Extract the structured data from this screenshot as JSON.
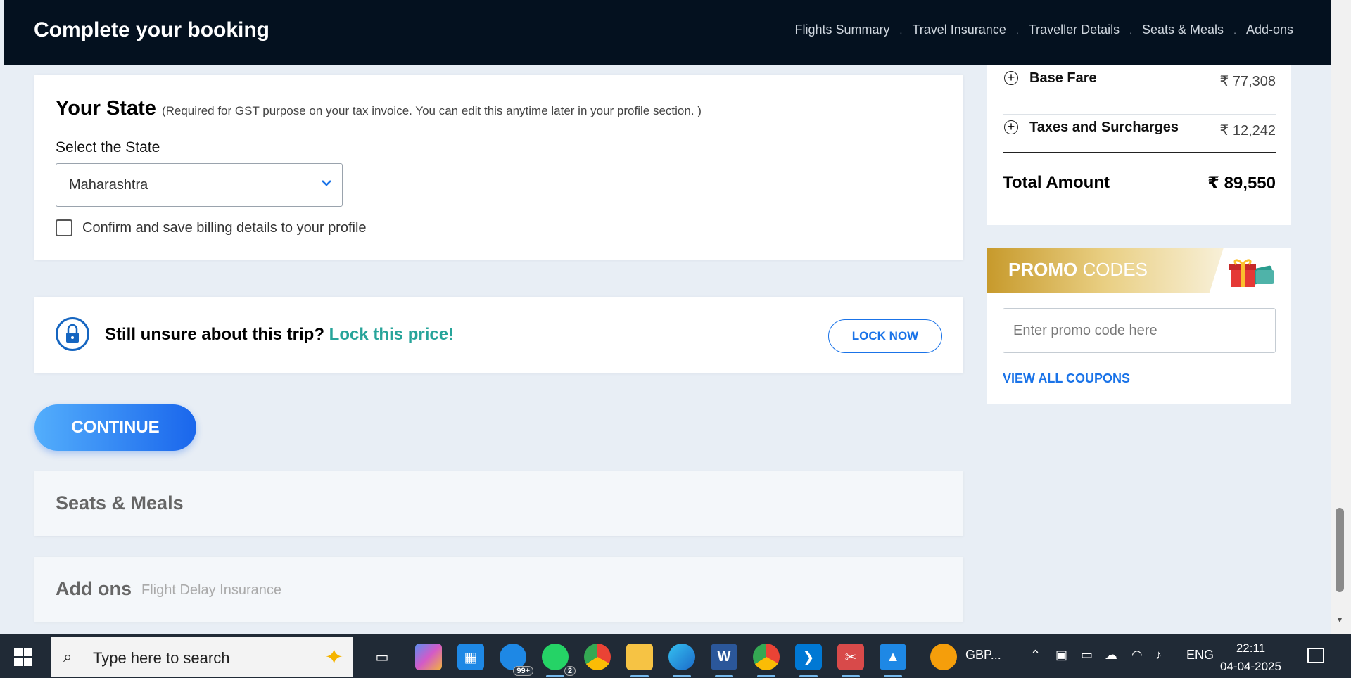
{
  "header": {
    "title": "Complete your booking",
    "steps": [
      "Flights Summary",
      "Travel Insurance",
      "Traveller Details",
      "Seats & Meals",
      "Add-ons"
    ],
    "separator": "."
  },
  "state_section": {
    "heading": "Your State",
    "note": "(Required for GST purpose on your tax invoice. You can edit this anytime later in your profile section. )",
    "select_label": "Select the State",
    "selected_state": "Maharashtra",
    "checkbox_label": "Confirm and save billing details to your profile"
  },
  "lock_section": {
    "question": "Still unsure about this trip?",
    "highlight": "Lock this price!",
    "button": "LOCK NOW"
  },
  "continue_label": "CONTINUE",
  "seats_section": {
    "title": "Seats & Meals"
  },
  "addons_section": {
    "title": "Add ons",
    "subtitle": "Flight Delay Insurance"
  },
  "fare_summary": {
    "rows": [
      {
        "label": "Base Fare",
        "amount": "₹ 77,308"
      },
      {
        "label": "Taxes and Surcharges",
        "amount": "₹ 12,242"
      }
    ],
    "total_label": "Total Amount",
    "total_amount": "₹ 89,550"
  },
  "promo": {
    "title_bold": "PROMO",
    "title_rest": "CODES",
    "placeholder": "Enter promo code here",
    "view_all": "VIEW ALL COUPONS"
  },
  "taskbar": {
    "search_placeholder": "Type here to search",
    "mail_badge": "99+",
    "whatsapp_badge": "2",
    "app_label": "GBP...",
    "language": "ENG",
    "time": "22:11",
    "date": "04-04-2025"
  }
}
